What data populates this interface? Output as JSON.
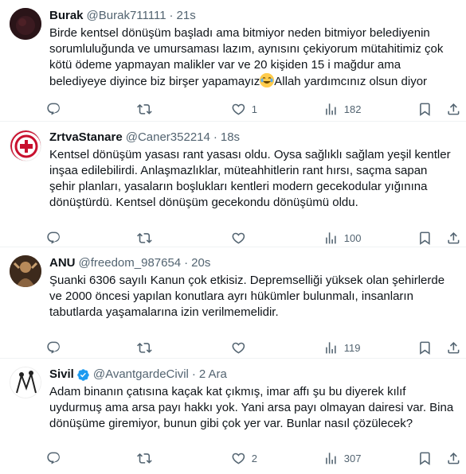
{
  "tweets": [
    {
      "name": "Burak",
      "handle": "@Burak711111",
      "time": "21s",
      "verified": false,
      "text": "Birde kentsel dönüşüm başladı ama bitmiyor neden bitmiyor belediyenin sorumluluğunda ve umursaması lazım, aynısını çekiyorum mütahitimiz çok kötü ödeme yapmayan malikler var ve 20 kişiden 15 i mağdur ama belediyeye diyince biz birşer yapamayız",
      "text_after_emoji": "Allah yardımcınız olsun diyor",
      "emoji": "joy-emoji",
      "replies": "",
      "retweets": "",
      "likes": "1",
      "views": "182"
    },
    {
      "name": "ZrtvaStanare",
      "handle": "@Caner352214",
      "time": "18s",
      "verified": false,
      "text": "Kentsel dönüşüm yasası rant yasası oldu. Oysa sağlıklı sağlam yeşil kentler inşaa edilebilirdi. Anlaşmazlıklar, müteahhitlerin rant hırsı, saçma sapan şehir planları, yasaların boşlukları kentleri modern gecekodular yığınına dönüştürdü. Kentsel dönüşüm gecekondu dönüşümü oldu.",
      "replies": "",
      "retweets": "",
      "likes": "",
      "views": "100"
    },
    {
      "name": "ANU",
      "handle": "@freedom_987654",
      "time": "20s",
      "verified": false,
      "text": "Şuanki 6306 sayılı Kanun çok etkisiz. Depremselliği yüksek olan şehirlerde ve 2000 öncesi yapılan konutlara ayrı hükümler bulunmalı, insanların tabutlarda yaşamalarına izin verilmemelidir.",
      "replies": "",
      "retweets": "",
      "likes": "",
      "views": "119"
    },
    {
      "name": "Sivil",
      "handle": "@AvantgardeCivil",
      "time": "2 Ara",
      "verified": true,
      "text": "Adam binanın çatısına kaçak kat çıkmış, imar affı şu bu diyerek kılıf uydurmuş ama arsa payı hakkı yok. Yani arsa payı  olmayan dairesi var. Bina dönüşüme giremiyor, bunun gibi çok yer var. Bunlar nasıl çözülecek?",
      "replies": "",
      "retweets": "",
      "likes": "2",
      "views": "307"
    }
  ],
  "colors": {
    "text": "#0f1419",
    "secondary": "#536471",
    "divider": "#eff3f4",
    "verified": "#1d9bf0"
  },
  "icons": {
    "reply": "reply-icon",
    "retweet": "retweet-icon",
    "like": "like-icon",
    "views": "views-icon",
    "bookmark": "bookmark-icon",
    "share": "share-icon",
    "verified": "verified-badge-icon"
  }
}
